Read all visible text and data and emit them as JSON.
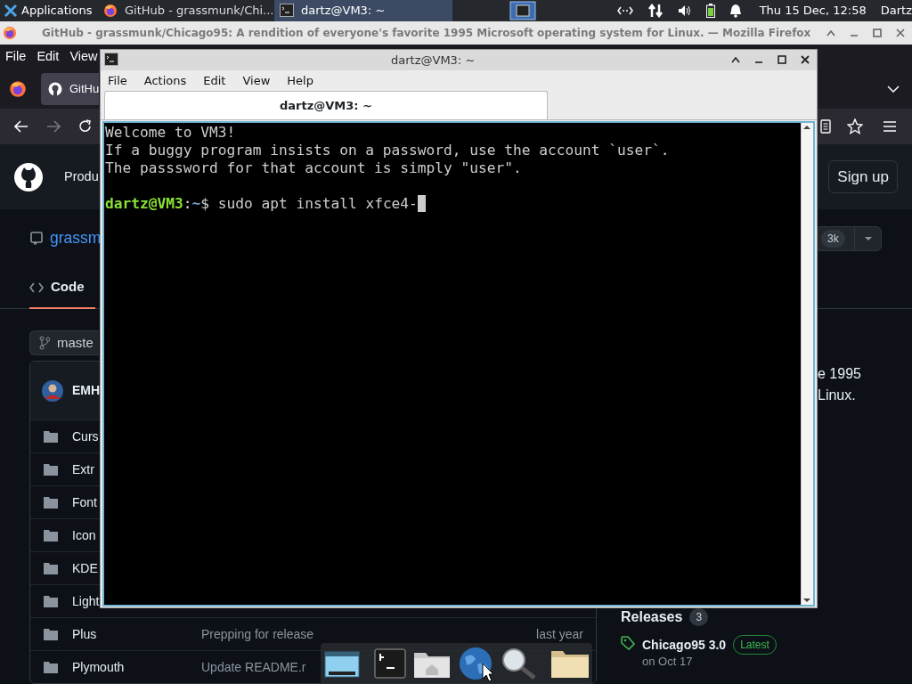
{
  "top_panel": {
    "apps_menu": "Applications",
    "tasks": [
      {
        "label": "GitHub - grassmunk/Chi...",
        "selected": false
      },
      {
        "label": "dartz@VM3: ~",
        "selected": true
      }
    ],
    "clock": "Thu 15 Dec, 12:58",
    "user": "Dartz"
  },
  "browser": {
    "title": "GitHub - grassmunk/Chicago95: A rendition of everyone's favorite 1995 Microsoft operating system for Linux. — Mozilla Firefox",
    "menu": [
      "File",
      "Edit",
      "View"
    ],
    "tab": "GitHu",
    "forward_disabled": true,
    "page": {
      "header_nav": "Produ",
      "sign_up": "Sign up",
      "repo_name": "grassm",
      "star_count": "3k",
      "tabs": [
        {
          "label": "Code",
          "selected": true
        }
      ],
      "branch": "maste",
      "about": [
        "e 1995",
        "Linux."
      ],
      "commit_author": "EMH",
      "files": [
        {
          "name": "Curs"
        },
        {
          "name": "Extr"
        },
        {
          "name": "Font"
        },
        {
          "name": "Icon"
        },
        {
          "name": "KDE"
        },
        {
          "name": "Light"
        },
        {
          "name": "Plus",
          "message": "Prepping for release",
          "time": "last year"
        },
        {
          "name": "Plymouth",
          "message": "Update README.r"
        }
      ],
      "releases": {
        "title": "Releases",
        "count": "3",
        "latest": {
          "name": "Chicago95 3.0",
          "badge": "Latest",
          "date": "on Oct 17"
        }
      }
    }
  },
  "terminal": {
    "title": "dartz@VM3: ~",
    "menu": [
      "File",
      "Actions",
      "Edit",
      "View",
      "Help"
    ],
    "tabs": [
      {
        "label": "dartz@VM3: ~",
        "selected": true
      }
    ],
    "lines": [
      "Welcome to VM3!",
      "If a buggy program insists on a password, use the account `user`.",
      "The passsword for that account is simply \"user\"."
    ],
    "prompt": {
      "user_host": "dartz@VM3",
      "separator": ":",
      "path": "~",
      "symbol": "$",
      "command": "sudo apt install xfce4-"
    }
  }
}
